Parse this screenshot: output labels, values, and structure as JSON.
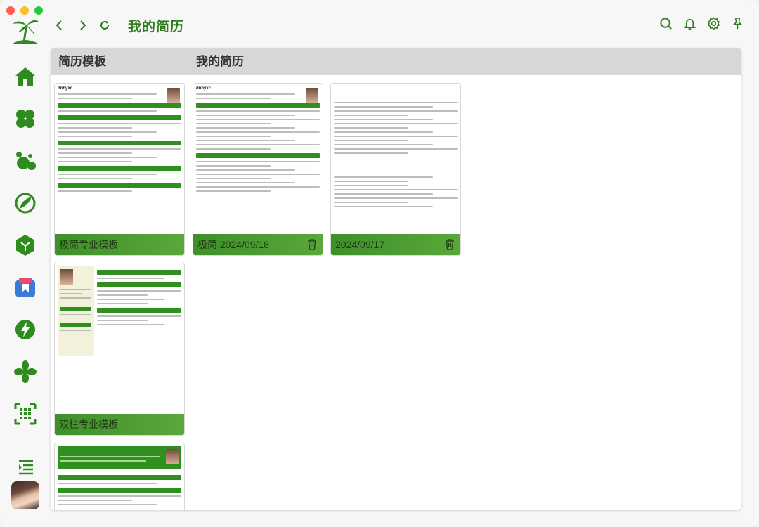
{
  "window": {
    "title": "我的简历"
  },
  "colors": {
    "accent": "#2e7d1e",
    "card_footer": "#4a9a2f",
    "panel_header": "#d7d7d7"
  },
  "sidebar": {
    "logo": "palm-island-logo",
    "items": [
      {
        "name": "home-icon"
      },
      {
        "name": "clover-icon"
      },
      {
        "name": "bubbles-icon"
      },
      {
        "name": "leaf-pen-icon"
      },
      {
        "name": "hexagon-icon"
      },
      {
        "name": "bookmark-app-icon"
      },
      {
        "name": "lightning-icon"
      },
      {
        "name": "asterisk-icon"
      },
      {
        "name": "grid-frame-icon"
      }
    ],
    "collapse_icon": "collapse-menu-icon"
  },
  "topbar": {
    "title": "我的简历",
    "actions": [
      "search-icon",
      "bell-icon",
      "gear-icon",
      "pin-icon"
    ]
  },
  "panel": {
    "left_title": "简历模板",
    "right_title": "我的简历"
  },
  "templates": [
    {
      "label": "极简专业模板"
    },
    {
      "label": "双栏专业模板"
    },
    {
      "label": ""
    }
  ],
  "resumes": [
    {
      "label": "极简 2024/09/18"
    },
    {
      "label": "2024/09/17"
    }
  ]
}
